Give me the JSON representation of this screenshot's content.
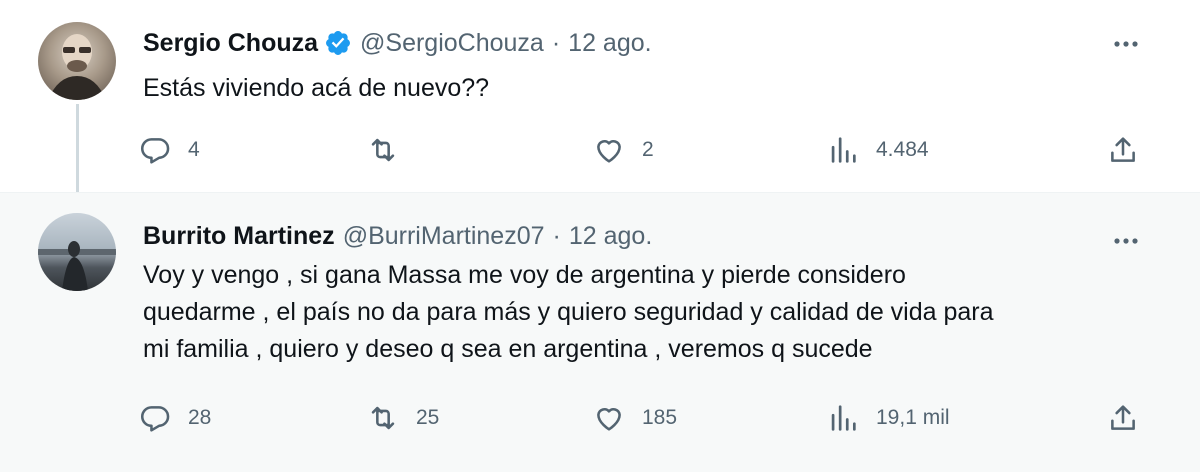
{
  "tweets": [
    {
      "name": "Sergio Chouza",
      "verified": true,
      "handle": "@SergioChouza",
      "separator": "·",
      "date": "12 ago.",
      "text": "Estás viviendo acá de nuevo??",
      "replies": "4",
      "retweets": "",
      "likes": "2",
      "views": "4.484"
    },
    {
      "name": "Burrito Martinez",
      "verified": false,
      "handle": "@BurriMartinez07",
      "separator": "·",
      "date": "12 ago.",
      "text_lines": [
        "Voy y vengo , si gana Massa me voy de argentina y pierde considero",
        "quedarme , el país no da para más y quiero seguridad y calidad de vida para",
        "mi familia , quiero y deseo q sea en argentina , veremos q sucede"
      ],
      "replies": "28",
      "retweets": "25",
      "likes": "185",
      "views": "19,1 mil"
    }
  ],
  "colors": {
    "text": "#0f1419",
    "secondary": "#536471",
    "verified": "#1d9bf0",
    "thread_line": "#cfd9de",
    "reply_background": "#f7f9f9"
  },
  "icons": [
    "reply-icon",
    "retweet-icon",
    "like-icon",
    "views-icon",
    "share-icon",
    "more-icon",
    "verified-icon"
  ]
}
